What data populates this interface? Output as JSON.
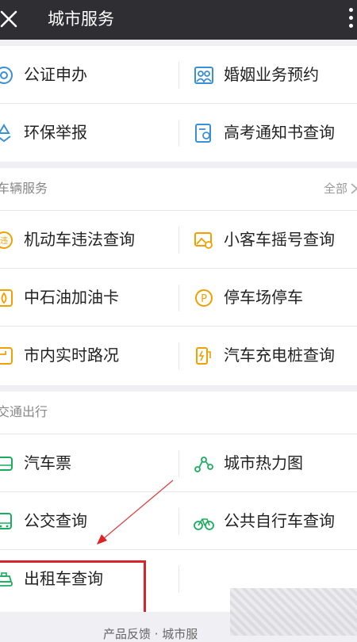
{
  "header": {
    "title": "城市服务"
  },
  "section1": {
    "rows": [
      {
        "left": "公证申办",
        "right": "婚姻业务预约"
      },
      {
        "left": "环保举报",
        "right": "高考通知书查询"
      }
    ]
  },
  "section2": {
    "name": "车辆服务",
    "all": "全部",
    "rows": [
      {
        "left": "机动车违法查询",
        "right": "小客车摇号查询"
      },
      {
        "left": "中石油加油卡",
        "right": "停车场停车"
      },
      {
        "left": "市内实时路况",
        "right": "汽车充电桩查询"
      }
    ]
  },
  "section3": {
    "name": "交通出行",
    "rows": [
      {
        "left": "汽车票",
        "right": "城市热力图"
      },
      {
        "left": "公交查询",
        "right": "公共自行车查询"
      },
      {
        "left": "出租车查询",
        "right": ""
      }
    ]
  },
  "footer": {
    "text": "产品反馈 · 城市服"
  },
  "colors": {
    "topbar": "#2f2f33",
    "icon_blue": "#3a8fd6",
    "icon_orange": "#f0a000",
    "icon_green": "#1aad5e",
    "highlight": "#d4262b"
  }
}
